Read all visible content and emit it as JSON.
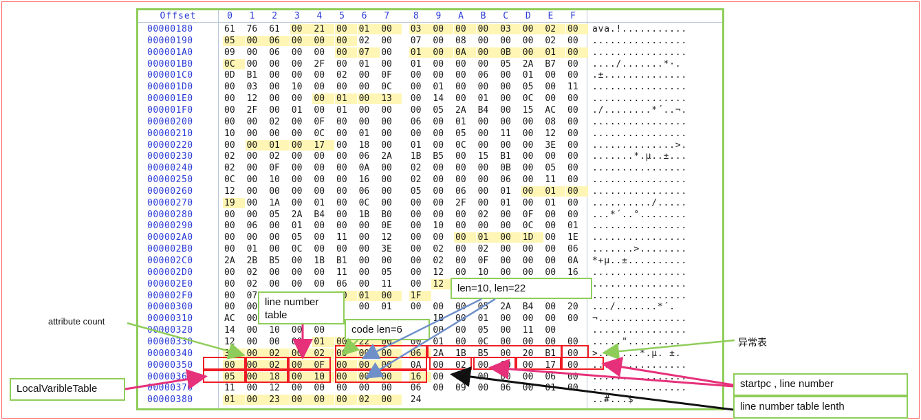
{
  "header": {
    "offset_label": "Offset",
    "columns": [
      "0",
      "1",
      "2",
      "3",
      "4",
      "5",
      "6",
      "7",
      "8",
      "9",
      "A",
      "B",
      "C",
      "D",
      "E",
      "F"
    ]
  },
  "rows": [
    {
      "offset": "00000180",
      "bytes": [
        "61",
        "76",
        "61",
        "00",
        "21",
        "00",
        "01",
        "00",
        "03",
        "00",
        "00",
        "00",
        "03",
        "00",
        "02",
        "00"
      ],
      "ascii": "ava.!..........."
    },
    {
      "offset": "00000190",
      "bytes": [
        "05",
        "00",
        "06",
        "00",
        "00",
        "00",
        "02",
        "00",
        "07",
        "00",
        "08",
        "00",
        "00",
        "00",
        "02",
        "00"
      ],
      "ascii": "................"
    },
    {
      "offset": "000001A0",
      "bytes": [
        "09",
        "00",
        "06",
        "00",
        "00",
        "00",
        "07",
        "00",
        "01",
        "00",
        "0A",
        "00",
        "0B",
        "00",
        "01",
        "00"
      ],
      "ascii": "................"
    },
    {
      "offset": "000001B0",
      "bytes": [
        "0C",
        "00",
        "00",
        "00",
        "2F",
        "00",
        "01",
        "00",
        "01",
        "00",
        "00",
        "00",
        "05",
        "2A",
        "B7",
        "00"
      ],
      "ascii": "..../.......*·."
    },
    {
      "offset": "000001C0",
      "bytes": [
        "0D",
        "B1",
        "00",
        "00",
        "00",
        "02",
        "00",
        "0F",
        "00",
        "00",
        "00",
        "06",
        "00",
        "01",
        "00",
        "00"
      ],
      "ascii": ".±.............."
    },
    {
      "offset": "000001D0",
      "bytes": [
        "00",
        "03",
        "00",
        "10",
        "00",
        "00",
        "00",
        "0C",
        "00",
        "01",
        "00",
        "00",
        "00",
        "05",
        "00",
        "11"
      ],
      "ascii": "................"
    },
    {
      "offset": "000001E0",
      "bytes": [
        "00",
        "12",
        "00",
        "00",
        "00",
        "01",
        "00",
        "13",
        "00",
        "14",
        "00",
        "01",
        "00",
        "0C",
        "00",
        "00"
      ],
      "ascii": "................"
    },
    {
      "offset": "000001F0",
      "bytes": [
        "00",
        "2F",
        "00",
        "01",
        "00",
        "01",
        "00",
        "00",
        "00",
        "05",
        "2A",
        "B4",
        "00",
        "15",
        "AC",
        "00"
      ],
      "ascii": "./........*´..¬."
    },
    {
      "offset": "00000200",
      "bytes": [
        "00",
        "00",
        "02",
        "00",
        "0F",
        "00",
        "00",
        "00",
        "06",
        "00",
        "01",
        "00",
        "00",
        "00",
        "08",
        "00"
      ],
      "ascii": "................"
    },
    {
      "offset": "00000210",
      "bytes": [
        "10",
        "00",
        "00",
        "00",
        "0C",
        "00",
        "01",
        "00",
        "00",
        "00",
        "05",
        "00",
        "11",
        "00",
        "12",
        "00"
      ],
      "ascii": "................"
    },
    {
      "offset": "00000220",
      "bytes": [
        "00",
        "00",
        "01",
        "00",
        "17",
        "00",
        "18",
        "00",
        "01",
        "00",
        "0C",
        "00",
        "00",
        "00",
        "3E",
        "00"
      ],
      "ascii": "..............>."
    },
    {
      "offset": "00000230",
      "bytes": [
        "02",
        "00",
        "02",
        "00",
        "00",
        "00",
        "06",
        "2A",
        "1B",
        "B5",
        "00",
        "15",
        "B1",
        "00",
        "00",
        "00"
      ],
      "ascii": ".......*.µ..±..."
    },
    {
      "offset": "00000240",
      "bytes": [
        "02",
        "00",
        "0F",
        "00",
        "00",
        "00",
        "0A",
        "00",
        "02",
        "00",
        "00",
        "00",
        "0B",
        "00",
        "05",
        "00"
      ],
      "ascii": "................"
    },
    {
      "offset": "00000250",
      "bytes": [
        "0C",
        "00",
        "10",
        "00",
        "00",
        "00",
        "16",
        "00",
        "02",
        "00",
        "00",
        "00",
        "06",
        "00",
        "11",
        "00"
      ],
      "ascii": "................"
    },
    {
      "offset": "00000260",
      "bytes": [
        "12",
        "00",
        "00",
        "00",
        "00",
        "00",
        "06",
        "00",
        "05",
        "00",
        "06",
        "00",
        "01",
        "00",
        "01",
        "00"
      ],
      "ascii": "................"
    },
    {
      "offset": "00000270",
      "bytes": [
        "19",
        "00",
        "1A",
        "00",
        "01",
        "00",
        "0C",
        "00",
        "00",
        "00",
        "2F",
        "00",
        "01",
        "00",
        "01",
        "00"
      ],
      "ascii": "........../....."
    },
    {
      "offset": "00000280",
      "bytes": [
        "00",
        "00",
        "05",
        "2A",
        "B4",
        "00",
        "1B",
        "B0",
        "00",
        "00",
        "00",
        "02",
        "00",
        "0F",
        "00",
        "00"
      ],
      "ascii": "...*´..°........"
    },
    {
      "offset": "00000290",
      "bytes": [
        "00",
        "06",
        "00",
        "01",
        "00",
        "00",
        "00",
        "0E",
        "00",
        "10",
        "00",
        "00",
        "00",
        "0C",
        "00",
        "01"
      ],
      "ascii": "................"
    },
    {
      "offset": "000002A0",
      "bytes": [
        "00",
        "00",
        "00",
        "05",
        "00",
        "11",
        "00",
        "12",
        "00",
        "00",
        "00",
        "01",
        "00",
        "1D",
        "00",
        "1E"
      ],
      "ascii": "................"
    },
    {
      "offset": "000002B0",
      "bytes": [
        "00",
        "01",
        "00",
        "0C",
        "00",
        "00",
        "00",
        "3E",
        "00",
        "02",
        "00",
        "02",
        "00",
        "00",
        "00",
        "06"
      ],
      "ascii": ".......>........"
    },
    {
      "offset": "000002C0",
      "bytes": [
        "2A",
        "2B",
        "B5",
        "00",
        "1B",
        "B1",
        "00",
        "00",
        "00",
        "02",
        "00",
        "0F",
        "00",
        "00",
        "00",
        "0A"
      ],
      "ascii": "*+µ..±.........."
    },
    {
      "offset": "000002D0",
      "bytes": [
        "00",
        "02",
        "00",
        "00",
        "00",
        "11",
        "00",
        "05",
        "00",
        "12",
        "00",
        "10",
        "00",
        "00",
        "00",
        "16"
      ],
      "ascii": "................"
    },
    {
      "offset": "000002E0",
      "bytes": [
        "00",
        "02",
        "00",
        "00",
        "00",
        "06",
        "00",
        "11",
        "00",
        "12",
        "",
        "",
        "",
        "",
        "",
        ""
      ],
      "ascii": "................"
    },
    {
      "offset": "000002F0",
      "bytes": [
        "00",
        "07",
        "",
        "",
        "",
        "00",
        "01",
        "00",
        "1F",
        "",
        "",
        "",
        "",
        "",
        "",
        ""
      ],
      "ascii": "................"
    },
    {
      "offset": "00000300",
      "bytes": [
        "00",
        "00",
        "",
        "",
        "",
        "",
        "00",
        "01",
        "00",
        "00",
        "00",
        "05",
        "2A",
        "B4",
        "00",
        "20"
      ],
      "ascii": ".../.......*´."
    },
    {
      "offset": "00000310",
      "bytes": [
        "AC",
        "00",
        "",
        "",
        "",
        "",
        "",
        "",
        "",
        "1B",
        "00",
        "01",
        "00",
        "00",
        "00",
        "00"
      ],
      "ascii": "¬..............."
    },
    {
      "offset": "00000320",
      "bytes": [
        "14",
        "00",
        "10",
        "00",
        "00",
        "",
        "",
        "",
        "00",
        "00",
        "00",
        "05",
        "00",
        "11",
        "00"
      ],
      "ascii": "................"
    },
    {
      "offset": "00000330",
      "bytes": [
        "12",
        "00",
        "00",
        "00",
        "01",
        "00",
        "22",
        "00",
        "00",
        "01",
        "00",
        "0C",
        "00",
        "00",
        "00",
        "00"
      ],
      "ascii": ".....\"........."
    },
    {
      "offset": "00000340",
      "bytes": [
        "3E",
        "00",
        "02",
        "00",
        "02",
        "00",
        "00",
        "00",
        "06",
        "2A",
        "1B",
        "B5",
        "00",
        "20",
        "B1",
        "00"
      ],
      "ascii": ">.......*.µ. ±."
    },
    {
      "offset": "00000350",
      "bytes": [
        "00",
        "00",
        "02",
        "00",
        "0F",
        "00",
        "00",
        "00",
        "0A",
        "00",
        "02",
        "00",
        "00",
        "00",
        "17",
        "00"
      ],
      "ascii": "................"
    },
    {
      "offset": "00000360",
      "bytes": [
        "05",
        "00",
        "18",
        "00",
        "10",
        "00",
        "00",
        "00",
        "16",
        "00",
        "02",
        "00",
        "00",
        "00",
        "06",
        "00"
      ],
      "ascii": "................"
    },
    {
      "offset": "00000370",
      "bytes": [
        "11",
        "00",
        "12",
        "00",
        "00",
        "00",
        "00",
        "00",
        "06",
        "00",
        "09",
        "00",
        "06",
        "00",
        "01",
        "00"
      ],
      "ascii": "................"
    },
    {
      "offset": "00000380",
      "bytes": [
        "01",
        "00",
        "23",
        "00",
        "00",
        "00",
        "02",
        "00",
        "24",
        "",
        "",
        "",
        "",
        "",
        "",
        ""
      ],
      "ascii": "..#...$"
    }
  ],
  "labels": {
    "attribute_count": "attribute count",
    "line_number_table": "line number table",
    "code_len": "code len=6",
    "len_values": "len=10,  len=22",
    "exception_table": "异常表",
    "startpc_line": "startpc , line number",
    "local_variable_table": "LocalVaribleTable",
    "line_number_table_length": "line number table lenth"
  },
  "colors": {
    "frame_green": "#8fcd5a",
    "offset_blue": "#2a3bd6",
    "highlight_yellow": "#fff6b5",
    "annotation_red": "#ee1c24",
    "arrow_pink": "#e6307a",
    "arrow_blue": "#6f8fc8"
  }
}
